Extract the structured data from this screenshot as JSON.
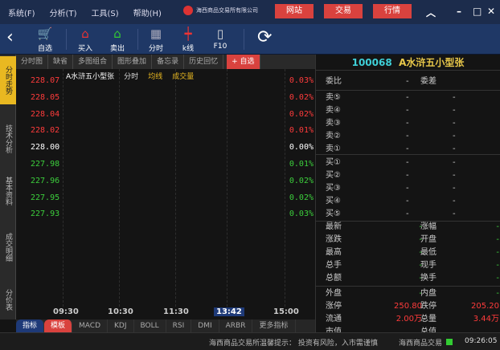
{
  "menu": [
    "系统(F)",
    "分析(T)",
    "工具(S)",
    "帮助(H)"
  ],
  "logo_text": "海西商品交易所有限公司",
  "top_buttons": [
    "网站",
    "交易",
    "行情"
  ],
  "toolbar": [
    "自选",
    "买入",
    "卖出",
    "分时",
    "k线",
    "F10"
  ],
  "tabs": [
    "分时图",
    "缺省",
    "多图组合",
    "图形叠加",
    "备忘录",
    "历史回忆",
    "+ 自选"
  ],
  "side_tabs": [
    "分时走势",
    "技术分析",
    "基本资料",
    "成交明细",
    "分价表"
  ],
  "legend": {
    "name": "A水浒五小型张",
    "a": "分时",
    "b": "均线",
    "c": "成交量"
  },
  "prices": [
    {
      "p": "228.07",
      "c": "0.03%",
      "color": "#ff3b3b"
    },
    {
      "p": "228.05",
      "c": "0.02%",
      "color": "#ff3b3b"
    },
    {
      "p": "228.04",
      "c": "0.02%",
      "color": "#ff3b3b"
    },
    {
      "p": "228.02",
      "c": "0.01%",
      "color": "#ff3b3b"
    },
    {
      "p": "228.00",
      "c": "0.00%",
      "color": "#ffffff"
    },
    {
      "p": "227.98",
      "c": "0.01%",
      "color": "#3ccf3c"
    },
    {
      "p": "227.96",
      "c": "0.02%",
      "color": "#3ccf3c"
    },
    {
      "p": "227.95",
      "c": "0.02%",
      "color": "#3ccf3c"
    },
    {
      "p": "227.93",
      "c": "0.03%",
      "color": "#3ccf3c"
    }
  ],
  "times": [
    "09:30",
    "10:30",
    "11:30",
    "13:42",
    "15:00"
  ],
  "indicators": [
    "指标",
    "模板",
    "MACD",
    "KDJ",
    "BOLL",
    "RSI",
    "DMI",
    "ARBR",
    "更多指标"
  ],
  "quote": {
    "code": "100068",
    "name": "A水浒五小型张"
  },
  "ratio": {
    "l1": "委比",
    "v1": "-",
    "l2": "委差",
    "v2": "-"
  },
  "orders": [
    "卖⑤",
    "卖④",
    "卖③",
    "卖②",
    "卖①",
    "买①",
    "买②",
    "买③",
    "买④",
    "买⑤"
  ],
  "dash": "-",
  "stats": [
    {
      "l1": "最新",
      "v1": "-",
      "l2": "涨幅",
      "v2": "-"
    },
    {
      "l1": "涨跌",
      "v1": "-",
      "l2": "开盘",
      "v2": "-"
    },
    {
      "l1": "最高",
      "v1": "-",
      "l2": "最低",
      "v2": "-"
    },
    {
      "l1": "总手",
      "v1": "-",
      "l2": "现手",
      "v2": "-"
    },
    {
      "l1": "总额",
      "v1": "-",
      "l2": "换手",
      "v2": "-"
    }
  ],
  "stats2": [
    {
      "l1": "外盘",
      "v1": "-",
      "l2": "内盘",
      "v2": "-"
    },
    {
      "l1": "涨停",
      "v1": "250.80",
      "l2": "跌停",
      "v2": "205.20"
    },
    {
      "l1": "流通",
      "v1": "2.00万",
      "l2": "总量",
      "v2": "3.44万"
    },
    {
      "l1": "市值",
      "v1": "",
      "l2": "总值",
      "v2": ""
    }
  ],
  "status": {
    "notice": "海西商品交易所温馨提示：  投资有风险，入市需谨慎",
    "exchange": "海西商品交易",
    "time": "09:26:05"
  }
}
